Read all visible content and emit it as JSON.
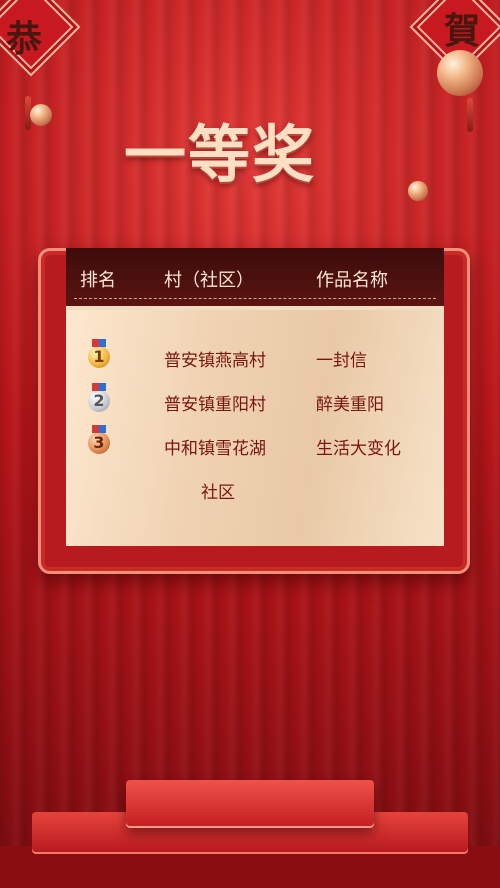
{
  "title": "一等奖",
  "decor": {
    "left_char": "恭",
    "right_char": "賀"
  },
  "table": {
    "headers": {
      "rank": "排名",
      "village": "村（社区）",
      "work": "作品名称"
    },
    "rows": [
      {
        "rank": "1",
        "village": "普安镇燕高村",
        "work": "一封信"
      },
      {
        "rank": "2",
        "village": "普安镇重阳村",
        "work": "醉美重阳"
      },
      {
        "rank": "3",
        "village": "中和镇雪花湖",
        "village_cont": "社区",
        "work": "生活大变化"
      }
    ]
  },
  "colors": {
    "background": "#b9161a",
    "panel": "#f2dcc0",
    "header": "#3c0c0b",
    "text": "#7a1410",
    "title": "#ffdfc4"
  }
}
